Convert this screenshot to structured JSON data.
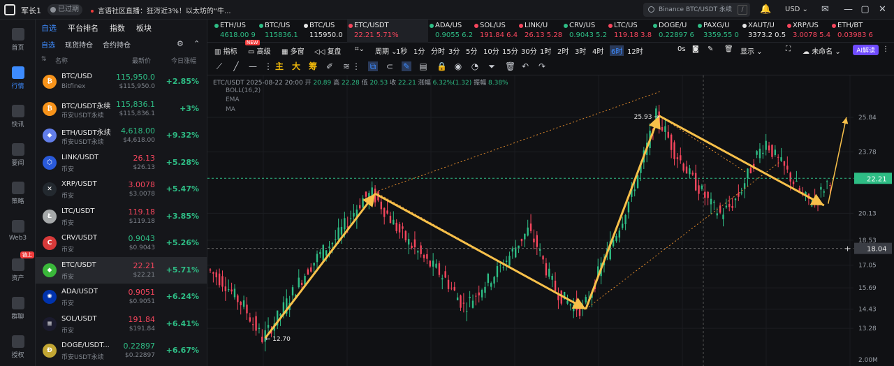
{
  "topbar": {
    "username": "军长1",
    "expired": "已过期",
    "news": "言语社区直播：狂泻近3%！以太坊的“牛...",
    "search_placeholder": "Binance BTC/USDT 永续",
    "currency": "USD"
  },
  "leftnav": [
    {
      "label": "首页",
      "icon": "home-icon",
      "active": false
    },
    {
      "label": "行情",
      "icon": "chart-bar-icon",
      "active": true
    },
    {
      "label": "快讯",
      "icon": "news-icon",
      "active": false
    },
    {
      "label": "要闻",
      "icon": "headline-icon",
      "active": false
    },
    {
      "label": "策略",
      "icon": "robot-icon",
      "active": false
    },
    {
      "label": "Web3",
      "icon": "web3-icon",
      "active": false
    },
    {
      "label": "资产",
      "icon": "wallet-icon",
      "active": false,
      "badge": "链上"
    },
    {
      "label": "群聊",
      "icon": "chat-icon",
      "active": false
    },
    {
      "label": "授权",
      "icon": "authorize-icon",
      "active": false
    }
  ],
  "watchlist": {
    "tabs": [
      "自选",
      "平台排名",
      "指数",
      "板块"
    ],
    "active_tab": "自选",
    "subtabs": [
      "自选",
      "现货持仓",
      "合约持仓"
    ],
    "active_subtab": "自选",
    "columns": {
      "name": "名称",
      "price": "最新价",
      "change": "今日涨幅"
    },
    "rows": [
      {
        "pair": "BTC/USD",
        "exchange": "Bitfinex",
        "price": "115,950.0",
        "sub": "$115,950.0",
        "change": "+2.85%",
        "dir": "up",
        "coin_color": "#f7931a",
        "coin_glyph": "₿",
        "selected": false
      },
      {
        "pair": "BTC/USDT永续",
        "exchange": "币安USDT永续",
        "price": "115,836.1",
        "sub": "$115,836.1",
        "change": "+3%",
        "dir": "up",
        "coin_color": "#f7931a",
        "coin_glyph": "₿",
        "selected": false
      },
      {
        "pair": "ETH/USDT永续",
        "exchange": "币安USDT永续",
        "price": "4,618.00",
        "sub": "$4,618.00",
        "change": "+9.32%",
        "dir": "up",
        "coin_color": "#627eea",
        "coin_glyph": "◆",
        "selected": false
      },
      {
        "pair": "LINK/USDT",
        "exchange": "币安",
        "price": "26.13",
        "sub": "$26.13",
        "change": "+5.28%",
        "dir": "dn",
        "coin_color": "#2a5ada",
        "coin_glyph": "⬡",
        "selected": false
      },
      {
        "pair": "XRP/USDT",
        "exchange": "币安",
        "price": "3.0078",
        "sub": "$3.0078",
        "change": "+5.47%",
        "dir": "dn",
        "coin_color": "#23292f",
        "coin_glyph": "✕",
        "selected": false
      },
      {
        "pair": "LTC/USDT",
        "exchange": "币安",
        "price": "119.18",
        "sub": "$119.18",
        "change": "+3.85%",
        "dir": "dn",
        "coin_color": "#a6a9aa",
        "coin_glyph": "Ł",
        "selected": false
      },
      {
        "pair": "CRV/USDT",
        "exchange": "币安",
        "price": "0.9043",
        "sub": "$0.9043",
        "change": "+5.26%",
        "dir": "up",
        "coin_color": "#d83a3a",
        "coin_glyph": "C",
        "selected": false
      },
      {
        "pair": "ETC/USDT",
        "exchange": "币安",
        "price": "22.21",
        "sub": "$22.21",
        "change": "+5.71%",
        "dir": "dn",
        "coin_color": "#3ab83a",
        "coin_glyph": "◆",
        "selected": true
      },
      {
        "pair": "ADA/USDT",
        "exchange": "币安",
        "price": "0.9051",
        "sub": "$0.9051",
        "change": "+6.24%",
        "dir": "dn",
        "coin_color": "#0033ad",
        "coin_glyph": "✺",
        "selected": false
      },
      {
        "pair": "SOL/USDT",
        "exchange": "币安",
        "price": "191.84",
        "sub": "$191.84",
        "change": "+6.41%",
        "dir": "dn",
        "coin_color": "#1b1b2e",
        "coin_glyph": "≡",
        "selected": false
      },
      {
        "pair": "DOGE/USDT...",
        "exchange": "币安USDT永续",
        "price": "0.22897",
        "sub": "$0.22897",
        "change": "+6.67%",
        "dir": "up",
        "coin_color": "#c2a633",
        "coin_glyph": "Ð",
        "selected": false
      }
    ]
  },
  "tickers": [
    {
      "name": "ETH/US",
      "price": "4618.00 9",
      "dir": "up"
    },
    {
      "name": "BTC/US",
      "price": "115836.1",
      "dir": "up"
    },
    {
      "name": "BTC/US",
      "price": "115950.0",
      "dir": "neutral"
    },
    {
      "name": "ETC/USDT",
      "price": "22.21 5.71%",
      "dir": "dn",
      "active": true
    },
    {
      "name": "ADA/US",
      "price": "0.9055 6.2",
      "dir": "up"
    },
    {
      "name": "SOL/US",
      "price": "191.84 6.4",
      "dir": "dn"
    },
    {
      "name": "LINK/U",
      "price": "26.13 5.28",
      "dir": "dn"
    },
    {
      "name": "CRV/US",
      "price": "0.9043 5.2",
      "dir": "up"
    },
    {
      "name": "LTC/US",
      "price": "119.18 3.8",
      "dir": "dn"
    },
    {
      "name": "DOGE/U",
      "price": "0.22897 6",
      "dir": "up"
    },
    {
      "name": "PAXG/U",
      "price": "3359.55 0",
      "dir": "up"
    },
    {
      "name": "XAUT/U",
      "price": "3373.2 0.5",
      "dir": "neutral"
    },
    {
      "name": "XRP/US",
      "price": "3.0078 5.4",
      "dir": "dn"
    },
    {
      "name": "ETH/BT",
      "price": "0.03983 6",
      "dir": "dn"
    }
  ],
  "toolbar": {
    "indicators": "指标",
    "new_badge": "NEW",
    "advanced": "高级",
    "multi": "多窗",
    "replay": "复盘",
    "period": "周期",
    "intervals": [
      "1秒",
      "1分",
      "分时",
      "3分",
      "5分",
      "10分",
      "15分",
      "30分",
      "1时",
      "2时",
      "3时",
      "4时",
      "6时",
      "12时"
    ],
    "active_interval": "6时",
    "countdown": "0s",
    "display": "显示",
    "unnamed": "未命名",
    "ai": "AI解读"
  },
  "drawbar": {
    "chars": [
      "主",
      "大",
      "筹"
    ]
  },
  "info": {
    "pair": "ETC/USDT",
    "datetime": "2025-08-22 20:00",
    "open_label": "开",
    "open": "20.89",
    "high_label": "高",
    "high": "22.28",
    "low_label": "低",
    "low": "20.53",
    "close_label": "收",
    "close": "22.21",
    "change_label": "涨幅",
    "change": "6.32%(1.32)",
    "amp_label": "振幅",
    "amp": "8.38%",
    "indicators": [
      "BOLL(16,2)",
      "EMA",
      "MA"
    ]
  },
  "chart_data": {
    "type": "candlestick",
    "pair": "ETC/USDT",
    "interval": "6时",
    "y_ticks": [
      25.84,
      23.78,
      20.13,
      18.53,
      17.05,
      15.69,
      14.43,
      13.28,
      "2.00M"
    ],
    "current_price": "22.21",
    "crosshair_price": "18.04",
    "annotations": {
      "high": "25.93",
      "low": "12.70"
    },
    "price_path": [
      16.8,
      16.4,
      15.9,
      15.2,
      14.6,
      13.6,
      12.7,
      13.4,
      14.2,
      15.1,
      16.0,
      16.8,
      17.5,
      18.1,
      18.6,
      19.4,
      20.2,
      21.0,
      21.3,
      20.6,
      19.8,
      19.0,
      18.4,
      17.8,
      17.2,
      16.8,
      16.2,
      15.4,
      14.6,
      15.1,
      15.8,
      16.3,
      16.9,
      17.6,
      18.4,
      19.1,
      18.2,
      16.8,
      15.6,
      15.0,
      14.6,
      14.4,
      15.6,
      17.0,
      18.2,
      19.4,
      20.8,
      22.4,
      24.1,
      25.93,
      25.0,
      23.8,
      23.0,
      22.1,
      21.4,
      20.6,
      20.1,
      20.5,
      21.2,
      22.4,
      23.6,
      24.4,
      23.5,
      22.8,
      22.0,
      21.1,
      20.8,
      21.4,
      22.21
    ],
    "trend_lines": {
      "arrow_up_1": [
        [
          12.7,
          0
        ],
        [
          21.3,
          18
        ]
      ],
      "arrow_down_1": [
        [
          21.3,
          18
        ],
        [
          14.43,
          41
        ]
      ],
      "arrow_up_2": [
        [
          14.43,
          41
        ],
        [
          25.93,
          49
        ]
      ],
      "arrow_down_2": [
        [
          25.93,
          49
        ],
        [
          20.6,
          67
        ]
      ],
      "arrow_up_3": [
        [
          20.6,
          67
        ],
        [
          25.84,
          70
        ]
      ]
    }
  }
}
